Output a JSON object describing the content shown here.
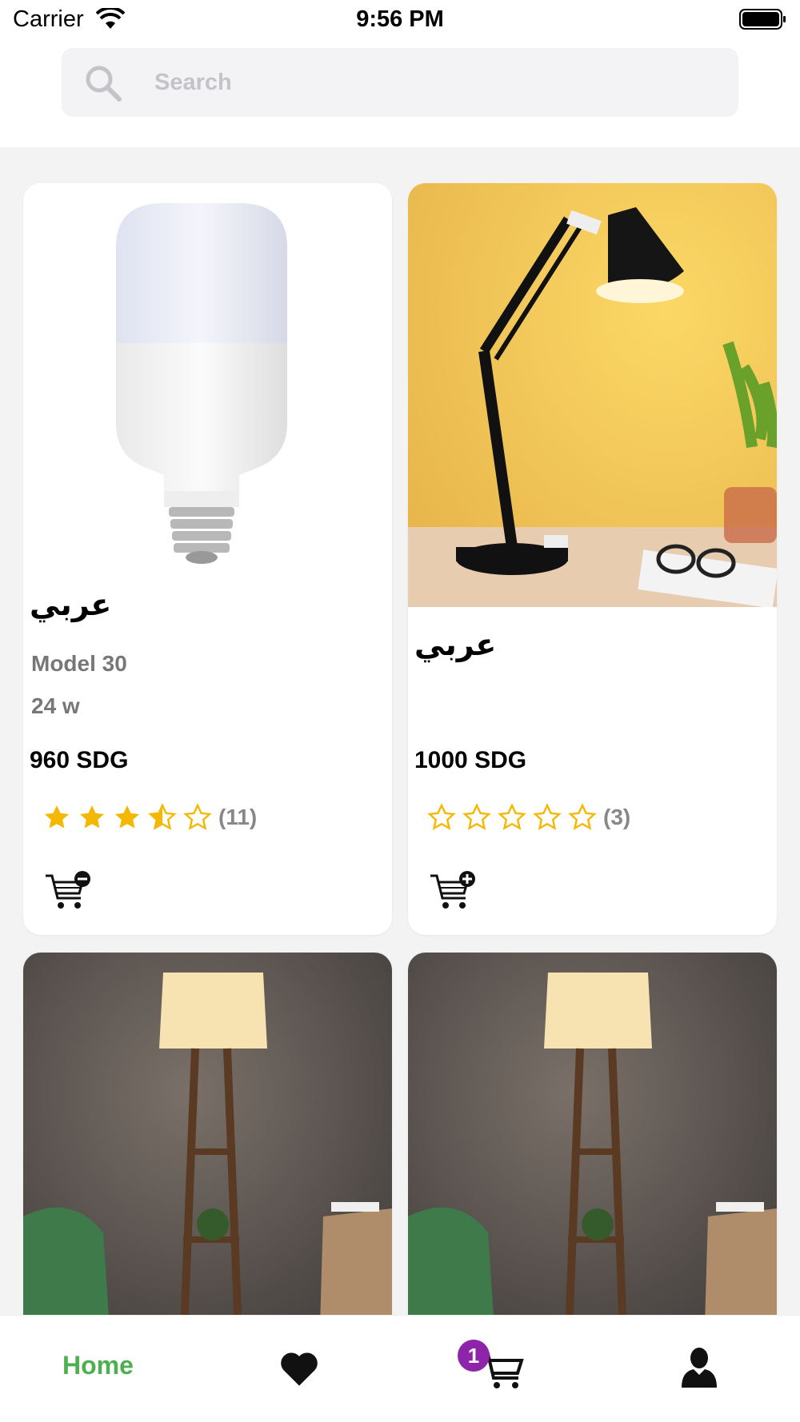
{
  "status_bar": {
    "carrier": "Carrier",
    "time": "9:56 PM"
  },
  "search": {
    "placeholder": "Search"
  },
  "products": [
    {
      "title": "عربي",
      "model": "Model 30",
      "watt": "24 w",
      "price": "960 SDG",
      "rating": 3.5,
      "rating_count": "(11)",
      "cart_action": "remove"
    },
    {
      "title": "عربي",
      "model": "",
      "watt": "",
      "price": "1000 SDG",
      "rating": 0,
      "rating_count": "(3)",
      "cart_action": "add"
    },
    {
      "title": "",
      "image": "floor-lamp"
    },
    {
      "title": "",
      "image": "floor-lamp"
    }
  ],
  "tabbar": {
    "home_label": "Home",
    "cart_badge": "1"
  },
  "colors": {
    "accent_green": "#4caf50",
    "star_yellow": "#f5b800",
    "badge_purple": "#8e24aa"
  },
  "icons": [
    "wifi-icon",
    "battery-icon",
    "search-icon",
    "star-icon",
    "cart-remove-icon",
    "cart-add-icon",
    "heart-icon",
    "cart-icon",
    "user-icon"
  ]
}
